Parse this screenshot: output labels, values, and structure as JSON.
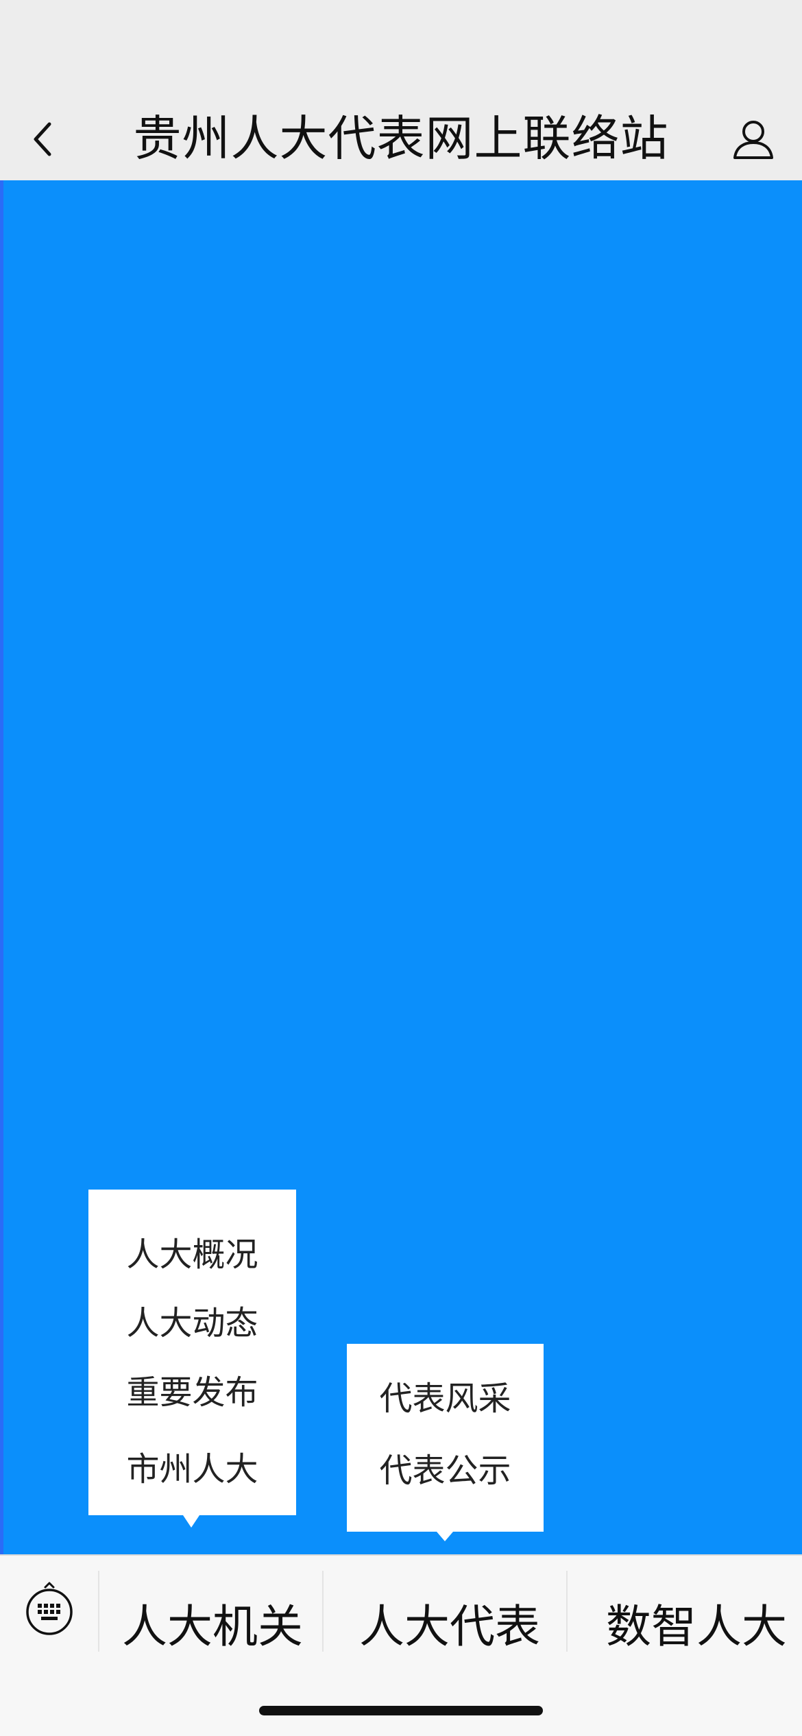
{
  "header": {
    "title": "贵州人大代表网上联络站"
  },
  "popup_left": {
    "items": [
      "人大概况",
      "人大动态",
      "重要发布",
      "市州人大"
    ]
  },
  "popup_right": {
    "items": [
      "代表风采",
      "代表公示"
    ]
  },
  "tabbar": {
    "tabs": [
      {
        "label": "人大机关"
      },
      {
        "label": "人大代表"
      },
      {
        "label": "数智人大"
      }
    ]
  },
  "colors": {
    "main_background": "#0b8ffb",
    "header_background": "#ededed",
    "tabbar_background": "#f7f7f7"
  },
  "icons": [
    "back-icon",
    "user-icon",
    "keyboard-icon"
  ]
}
